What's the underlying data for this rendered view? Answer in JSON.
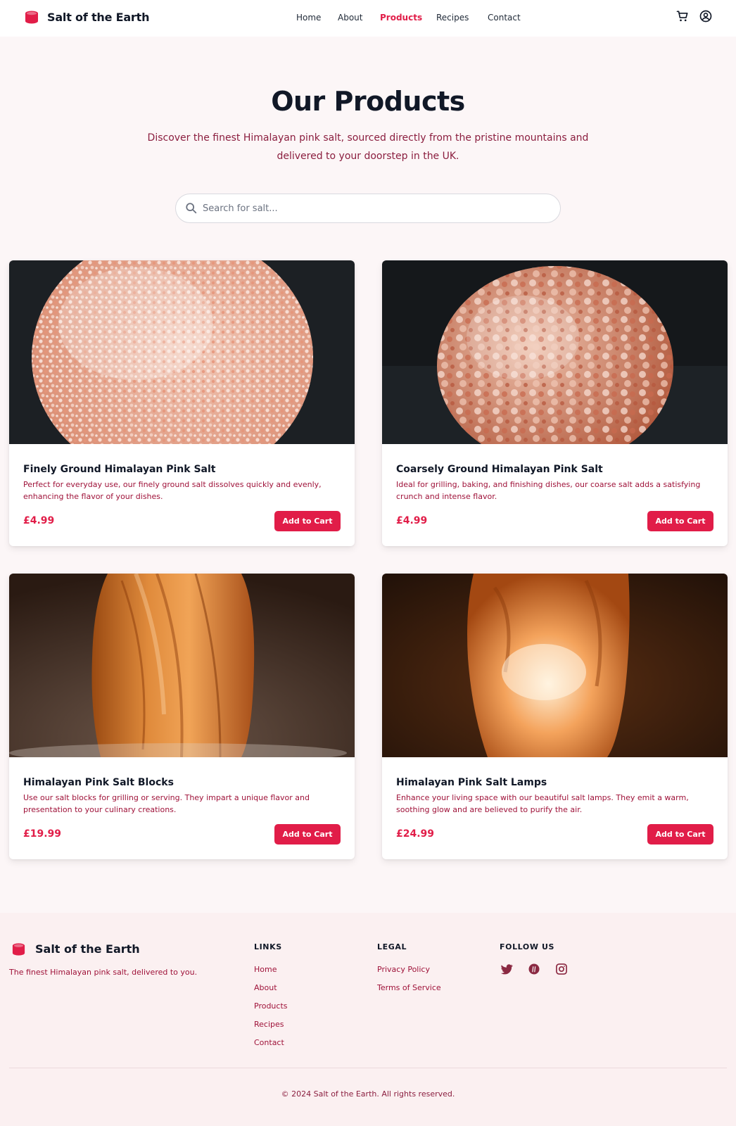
{
  "header": {
    "brand": "Salt of the Earth",
    "nav": [
      {
        "label": "Home",
        "active": false
      },
      {
        "label": "About",
        "active": false
      },
      {
        "label": "Products",
        "active": true
      },
      {
        "label": "Recipes",
        "active": false
      },
      {
        "label": "Contact",
        "active": false
      }
    ],
    "icons": [
      "cart-icon",
      "account-icon"
    ]
  },
  "hero": {
    "title": "Our Products",
    "subtitle": "Discover the finest Himalayan pink salt, sourced directly from the pristine mountains and delivered to your doorstep in the UK."
  },
  "search": {
    "placeholder": "Search for salt...",
    "value": ""
  },
  "products": [
    {
      "title": "Finely Ground Himalayan Pink Salt",
      "description": "Perfect for everyday use, our finely ground salt dissolves quickly and evenly, enhancing the flavor of your dishes.",
      "price": "£4.99",
      "button": "Add to Cart"
    },
    {
      "title": "Coarsely Ground Himalayan Pink Salt",
      "description": "Ideal for grilling, baking, and finishing dishes, our coarse salt adds a satisfying crunch and intense flavor.",
      "price": "£4.99",
      "button": "Add to Cart"
    },
    {
      "title": "Himalayan Pink Salt Blocks",
      "description": "Use our salt blocks for grilling or serving. They impart a unique flavor and presentation to your culinary creations.",
      "price": "£19.99",
      "button": "Add to Cart"
    },
    {
      "title": "Himalayan Pink Salt Lamps",
      "description": "Enhance your living space with our beautiful salt lamps. They emit a warm, soothing glow and are believed to purify the air.",
      "price": "£24.99",
      "button": "Add to Cart"
    }
  ],
  "footer": {
    "brand": "Salt of the Earth",
    "tagline": "The finest Himalayan pink salt, delivered to you.",
    "links_heading": "LINKS",
    "links": [
      "Home",
      "About",
      "Products",
      "Recipes",
      "Contact"
    ],
    "legal_heading": "LEGAL",
    "legal": [
      "Privacy Policy",
      "Terms of Service"
    ],
    "follow_heading": "FOLLOW US",
    "social_icons": [
      "twitter-icon",
      "pinterest-icon",
      "instagram-icon"
    ],
    "copyright": "© 2024 Salt of the Earth. All rights reserved."
  },
  "colors": {
    "accent": "#e11d48",
    "body_text": "#9f1239",
    "page_bg": "#fcf6f7",
    "footer_bg": "#fbf0f1"
  }
}
